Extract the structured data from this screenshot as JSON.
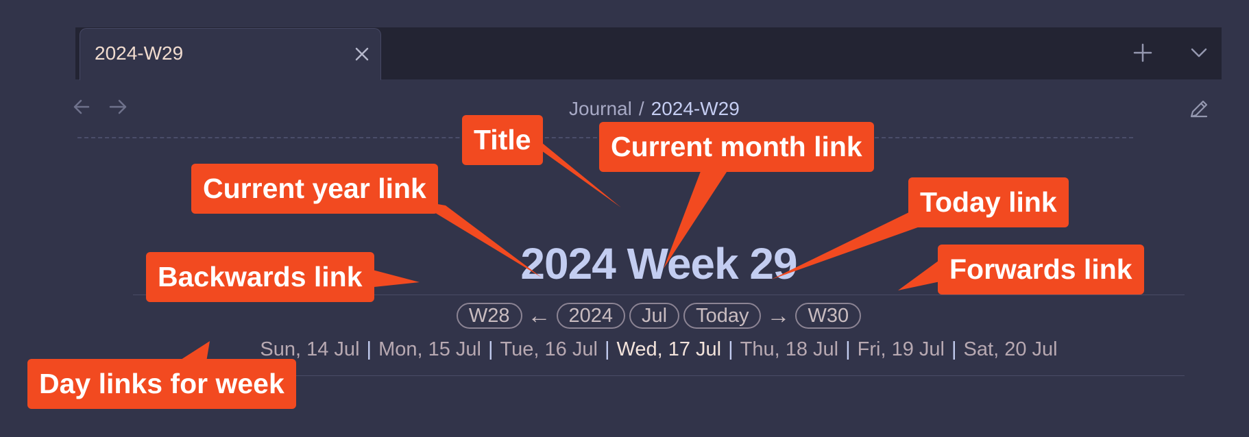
{
  "tab": {
    "title": "2024-W29"
  },
  "icons": {
    "close": "close-icon",
    "new_tab": "plus-icon",
    "tab_list": "chevron-down-icon",
    "back": "arrow-left-icon",
    "forward": "arrow-right-icon",
    "edit": "pencil-icon"
  },
  "breadcrumb": {
    "parent": "Journal",
    "separator": "/",
    "current": "2024-W29"
  },
  "note": {
    "title": "2024 Week 29",
    "nav": {
      "prev_week": "W28",
      "back_arrow": "←",
      "year": "2024",
      "month": "Jul",
      "today": "Today",
      "forward_arrow": "→",
      "next_week": "W30"
    },
    "days": [
      "Sun, 14 Jul",
      "Mon, 15 Jul",
      "Tue, 16 Jul",
      "Wed, 17 Jul",
      "Thu, 18 Jul",
      "Fri, 19 Jul",
      "Sat, 20 Jul"
    ],
    "day_separator": "|"
  },
  "callouts": {
    "title": "Title",
    "current_month": "Current month link",
    "current_year": "Current year link",
    "today": "Today link",
    "backwards": "Backwards link",
    "forwards": "Forwards link",
    "day_links": "Day links for week"
  },
  "colors": {
    "background": "#32344a",
    "tabbar": "#232433",
    "title": "#c3cdf1",
    "callout": "#f24a20"
  }
}
